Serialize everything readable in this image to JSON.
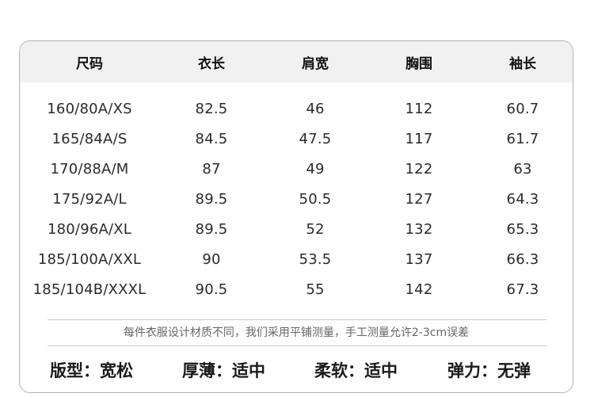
{
  "table": {
    "headers": [
      "尺码",
      "衣长",
      "肩宽",
      "胸围",
      "袖长"
    ],
    "rows": [
      [
        "160/80A/XS",
        "82.5",
        "46",
        "112",
        "60.7"
      ],
      [
        "165/84A/S",
        "84.5",
        "47.5",
        "117",
        "61.7"
      ],
      [
        "170/88A/M",
        "87",
        "49",
        "122",
        "63"
      ],
      [
        "175/92A/L",
        "89.5",
        "50.5",
        "127",
        "64.3"
      ],
      [
        "180/96A/XL",
        "89.5",
        "52",
        "132",
        "65.3"
      ],
      [
        "185/100A/XXL",
        "90",
        "53.5",
        "137",
        "66.3"
      ],
      [
        "185/104B/XXXL",
        "90.5",
        "55",
        "142",
        "67.3"
      ]
    ]
  },
  "note": "每件衣服设计材质不同，我们采用平铺测量，手工测量允许2-3cm误差",
  "properties": [
    "版型：宽松",
    "厚薄：适中",
    "柔软：适中",
    "弹力：无弹"
  ]
}
